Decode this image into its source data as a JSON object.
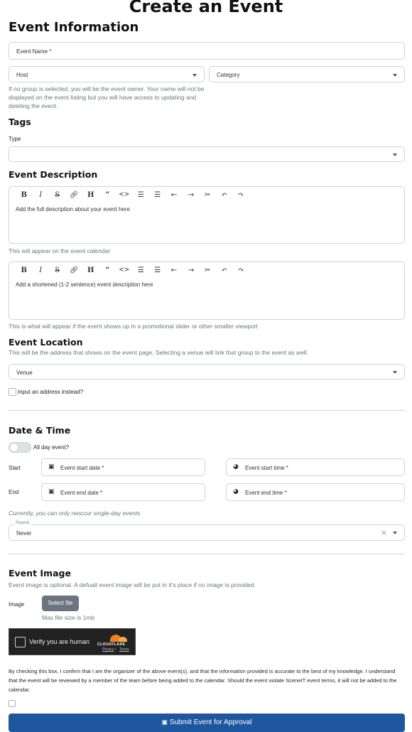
{
  "page_title": "Create an Event",
  "event_info": {
    "heading": "Event Information",
    "name_placeholder": "Event Name *",
    "host_label": "Host",
    "category_label": "Category",
    "host_help": "If no group is selected, you will be the event owner. Your name will not be displayed on the event listing but you will have access to updating and deleting the event."
  },
  "tags": {
    "heading": "Tags",
    "type_label": "Type"
  },
  "description": {
    "heading": "Event Description",
    "toolbar": [
      "B",
      "I",
      "S",
      "link",
      "H",
      "quote",
      "code",
      "bullet-list",
      "ordered-list",
      "outdent",
      "indent",
      "attach",
      "undo",
      "redo"
    ],
    "full_placeholder": "Add the full description about your event here",
    "full_help": "This will appear on the event calendar",
    "short_placeholder": "Add a shortened (1-2 sentence) event description here",
    "short_help": "This is what will appear if the event shows up in a promotional slider or other smaller viewport"
  },
  "location": {
    "heading": "Event Location",
    "help": "This will be the address that shows on the event page. Selecting a venue will link that group to the event as well.",
    "venue_label": "Venue",
    "address_checkbox": "Input an address instead?"
  },
  "datetime": {
    "heading": "Date & Time",
    "all_day": "All day event?",
    "start_label": "Start",
    "end_label": "End",
    "start_date": "Event start date *",
    "start_time": "Event start time *",
    "end_date": "Event end date *",
    "end_time": "Event end time *",
    "reoccur_note": "Currently, you can only reoccur single-day events",
    "repeat_label": "Repeat",
    "repeat_value": "Never"
  },
  "image": {
    "heading": "Event Image",
    "help": "Event image is optional. A defualt event image will be put in it's place if no image is provided.",
    "label": "Image",
    "select_button": "Select file",
    "max_size": "Max file size is 1mb"
  },
  "captcha": {
    "label": "Verify you are human",
    "brand": "CLOUDFLARE",
    "privacy": "Privacy",
    "separator": "•",
    "terms": "Terms"
  },
  "agreement": "By checking this box, I confirm that I am the organizer of the above event(s), and that the information provided is accurate to the best of my knowledge. I understand that the event will be reviewed by a member of the team before being added to the calendar. Should the event violate SceneIT event terms, it will not be added to the calendar.",
  "submit_button": "Submit Event for Approval"
}
